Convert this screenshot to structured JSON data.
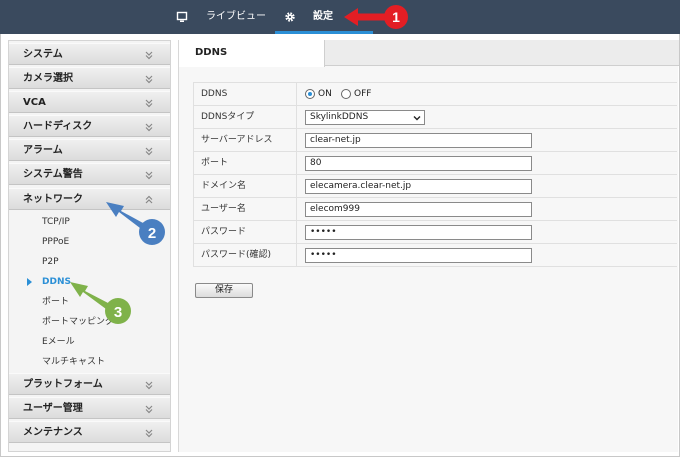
{
  "topbar": {
    "live_label": "ライブビュー",
    "settings_label": "設定"
  },
  "sidebar": {
    "sections": [
      {
        "label": "システム"
      },
      {
        "label": "カメラ選択"
      },
      {
        "label": "VCA"
      },
      {
        "label": "ハードディスク"
      },
      {
        "label": "アラーム"
      },
      {
        "label": "システム警告"
      },
      {
        "label": "ネットワーク"
      }
    ],
    "network_items": [
      {
        "label": "TCP/IP"
      },
      {
        "label": "PPPoE"
      },
      {
        "label": "P2P"
      },
      {
        "label": "DDNS"
      },
      {
        "label": "ポート"
      },
      {
        "label": "ポートマッピング"
      },
      {
        "label": "Eメール"
      },
      {
        "label": "マルチキャスト"
      }
    ],
    "bottom_sections": [
      {
        "label": "プラットフォーム"
      },
      {
        "label": "ユーザー管理"
      },
      {
        "label": "メンテナンス"
      }
    ]
  },
  "content": {
    "tab_label": "DDNS",
    "form": {
      "ddns_label": "DDNS",
      "on_label": "ON",
      "off_label": "OFF",
      "type_label": "DDNSタイプ",
      "type_value": "SkylinkDDNS",
      "server_label": "サーバーアドレス",
      "server_value": "clear-net.jp",
      "port_label": "ポート",
      "port_value": "80",
      "domain_label": "ドメイン名",
      "domain_value": "elecamera.clear-net.jp",
      "user_label": "ユーザー名",
      "user_value": "elecom999",
      "password_label": "パスワード",
      "password_value": "•••••",
      "confirm_label": "パスワード(確認)",
      "confirm_value": "•••••"
    },
    "save_label": "保存"
  },
  "annotations": {
    "callout_1": "1",
    "callout_2": "2",
    "callout_3": "3",
    "red": "#e31e24",
    "blue": "#4a7fc1",
    "green": "#7fb24a"
  }
}
